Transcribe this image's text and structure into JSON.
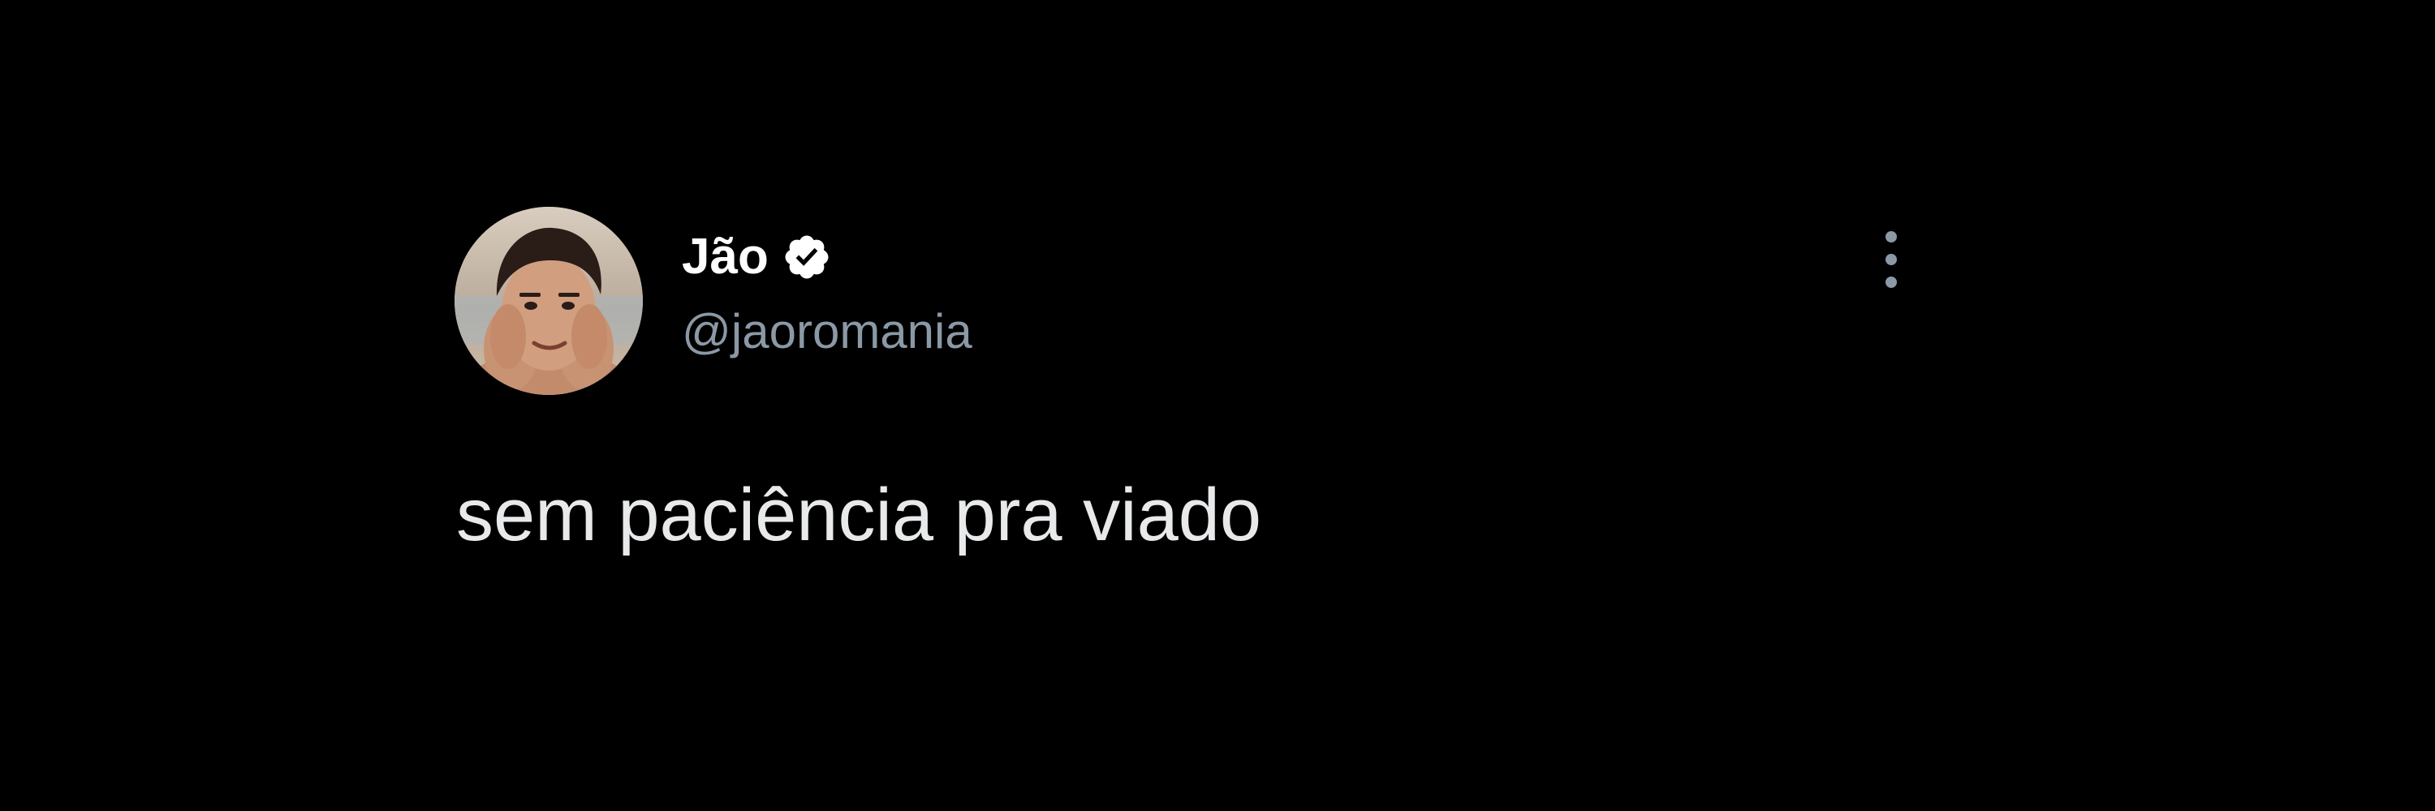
{
  "tweet": {
    "author": {
      "display_name": "Jão",
      "handle": "@jaoromania",
      "verified": true,
      "avatar_icon": "profile-photo"
    },
    "more_icon": "more-vertical-icon",
    "text": "sem paciência pra viado"
  },
  "colors": {
    "background": "#000000",
    "name": "#ffffff",
    "handle": "#8b98a5",
    "text": "#e7e9ea",
    "badge": "#ffffff"
  }
}
